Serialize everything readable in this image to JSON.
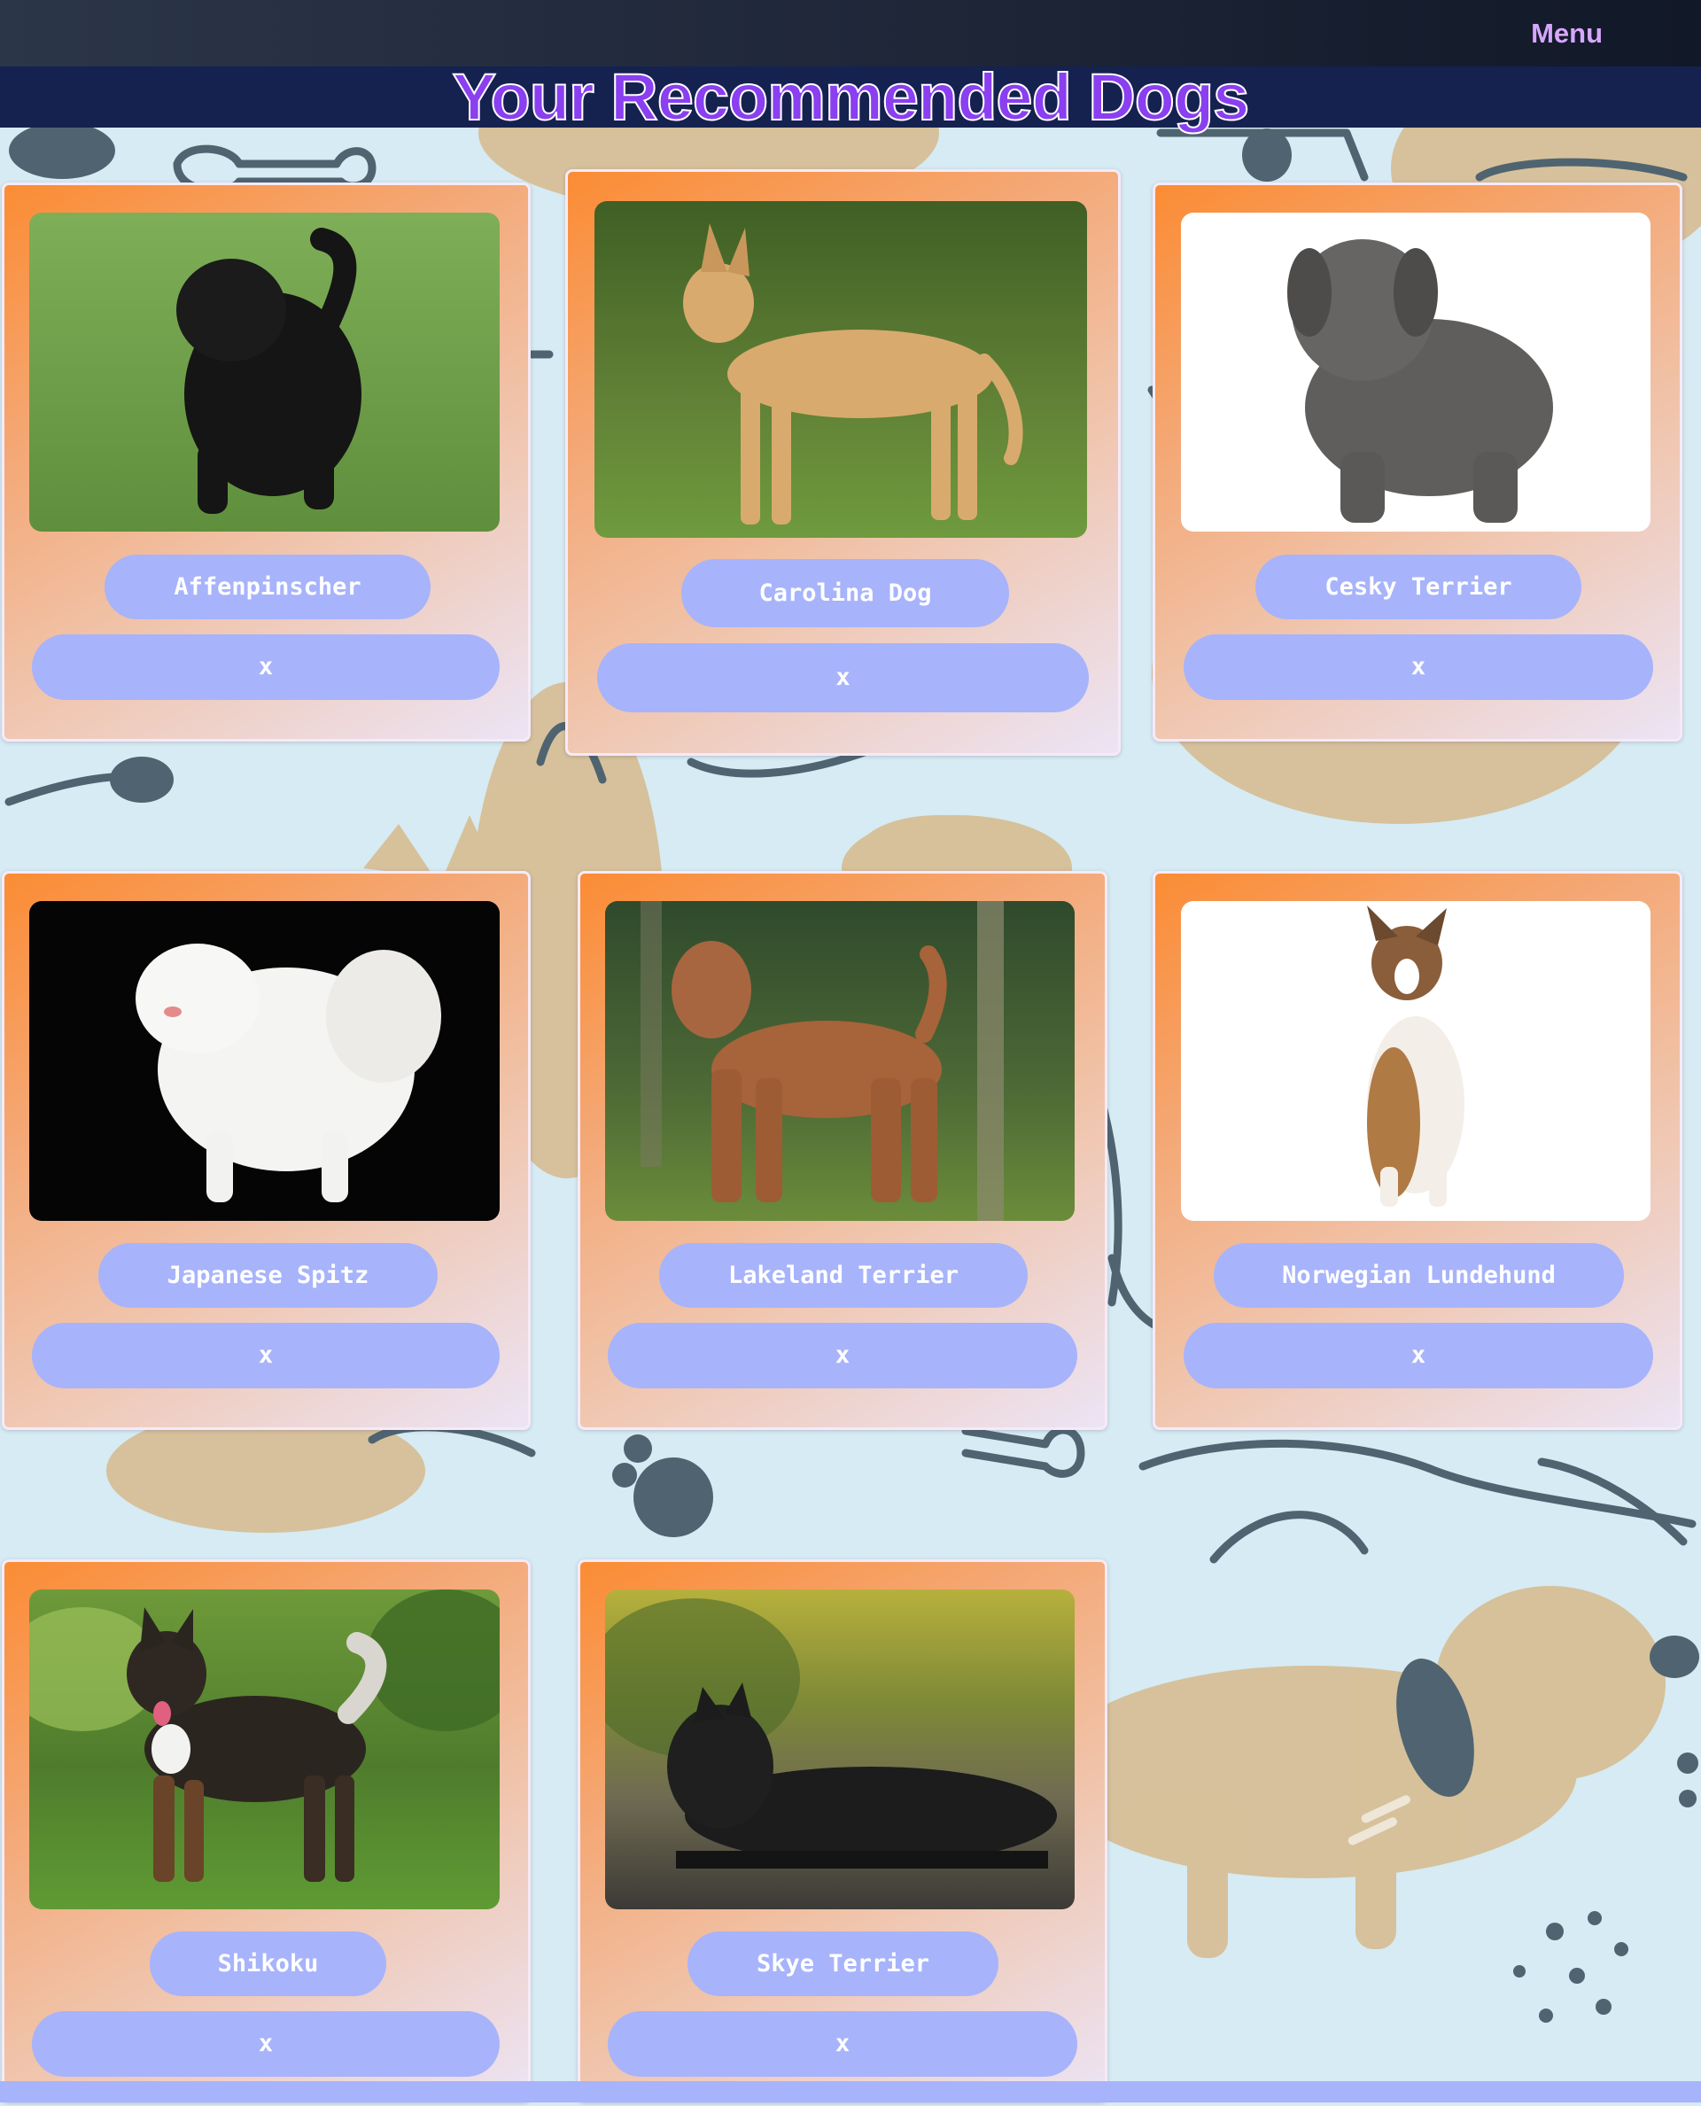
{
  "nav": {
    "menu_label": "Menu"
  },
  "page": {
    "title": "Your Recommended Dogs"
  },
  "dogs": [
    {
      "name": "Affenpinscher",
      "remove_label": "x",
      "photo": "black shaggy small dog on grass"
    },
    {
      "name": "Carolina Dog",
      "remove_label": "x",
      "photo": "tan dog standing on grass"
    },
    {
      "name": "Cesky Terrier",
      "remove_label": "x",
      "photo": "grey long-coated terrier on white"
    },
    {
      "name": "Japanese Spitz",
      "remove_label": "x",
      "photo": "white fluffy dog on black"
    },
    {
      "name": "Lakeland Terrier",
      "remove_label": "x",
      "photo": "brown terrier standing in forest"
    },
    {
      "name": "Norwegian Lundehund",
      "remove_label": "x",
      "photo": "small tricolor dog sitting on white"
    },
    {
      "name": "Shikoku",
      "remove_label": "x",
      "photo": "black and tan dog on grass with foliage"
    },
    {
      "name": "Skye Terrier",
      "remove_label": "x",
      "photo": "black long-haired terrier on path"
    }
  ],
  "colors": {
    "nav_bg": "#1e2638",
    "menu_text": "#d7a6ff",
    "title_band": "#15224f",
    "title_text": "#8a3ff0",
    "pill": "#a7b3fb",
    "card_gradient_start": "#fb8c34",
    "card_gradient_end": "#ece4f5",
    "page_bg": "#d6ebf3"
  }
}
